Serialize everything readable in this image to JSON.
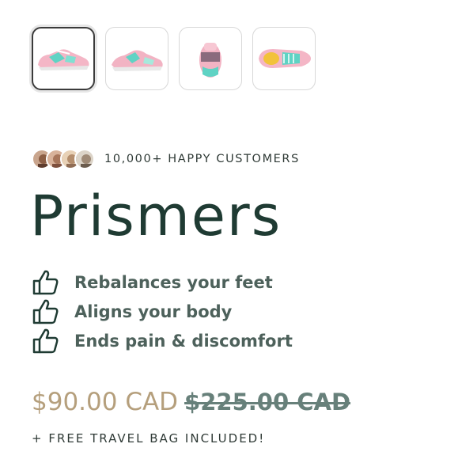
{
  "gallery": {
    "thumbnails": [
      {
        "icon": "shoe-side-thumbnail",
        "selected": true
      },
      {
        "icon": "shoe-side-thumbnail-alt",
        "selected": false
      },
      {
        "icon": "shoe-back-thumbnail",
        "selected": false
      },
      {
        "icon": "shoe-top-thumbnail",
        "selected": false
      }
    ]
  },
  "social_proof": {
    "text": "10,000+ HAPPY CUSTOMERS",
    "avatars": [
      "avatar-customer-1",
      "avatar-customer-2",
      "avatar-customer-3",
      "avatar-customer-4"
    ]
  },
  "product": {
    "title": "Prismers",
    "benefits": [
      {
        "icon": "thumbs-up-icon",
        "label": "Rebalances your feet"
      },
      {
        "icon": "thumbs-up-icon",
        "label": "Aligns your body"
      },
      {
        "icon": "thumbs-up-icon",
        "label": "Ends pain & discomfort"
      }
    ],
    "price": "$90.00 CAD",
    "compare_price": "$225.00 CAD",
    "bonus": "+ FREE TRAVEL BAG INCLUDED!"
  },
  "colors": {
    "title": "#1f3b33",
    "benefit_text": "#4d615b",
    "sale_price": "#b59f7c",
    "compare_price": "#67807a",
    "shoe_pink": "#f2b3c3",
    "shoe_teal": "#5fd3c4"
  }
}
